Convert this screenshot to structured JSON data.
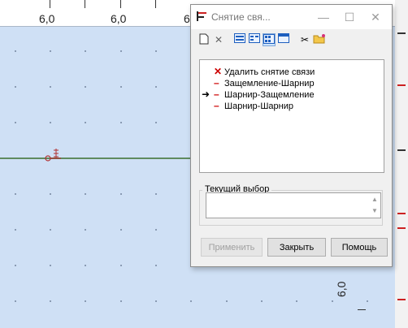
{
  "canvas": {
    "top_ruler_labels": [
      "6,0",
      "6,0",
      "6"
    ],
    "right_ruler_label": "6,0",
    "support_label": "sbv"
  },
  "dialog": {
    "title": "Снятие свя...",
    "window_buttons": {
      "minimize": "—",
      "maximize": "☐",
      "close": "✕"
    },
    "list_items": [
      {
        "label": "Удалить снятие связи",
        "mark": "✕",
        "selected_arrow": false
      },
      {
        "label": "Защемление-Шарнир",
        "mark": "–",
        "selected_arrow": false
      },
      {
        "label": "Шарнир-Защемление",
        "mark": "–",
        "selected_arrow": true,
        "arrow": "➜"
      },
      {
        "label": "Шарнир-Шарнир",
        "mark": "–",
        "selected_arrow": false
      }
    ],
    "current_selection_label": "Текущий выбор",
    "current_selection_value": "",
    "buttons": {
      "apply": "Применить",
      "close": "Закрыть",
      "help": "Помощь"
    }
  }
}
